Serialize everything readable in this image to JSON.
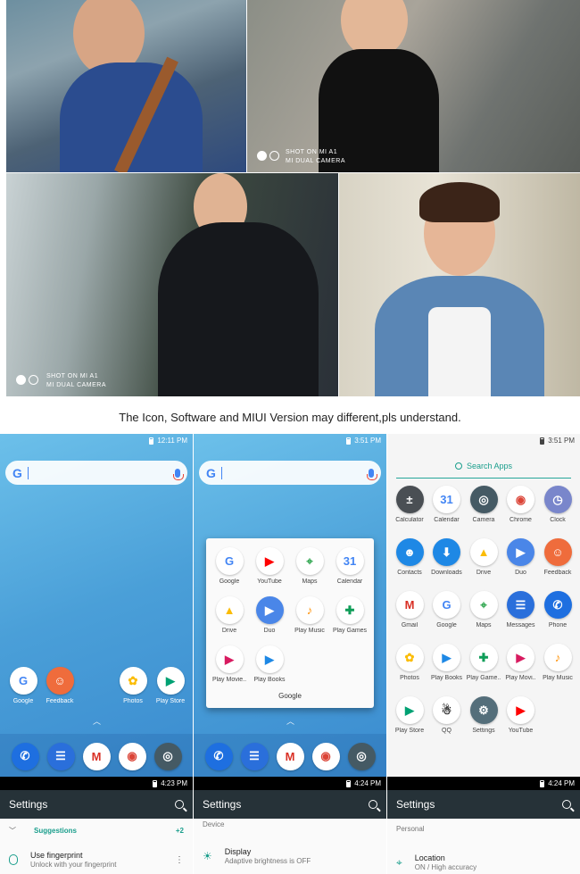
{
  "watermark": {
    "line1": "SHOT ON MI A1",
    "line2": "MI DUAL CAMERA"
  },
  "note": "The Icon, Software and MIUI Version may different,pls understand.",
  "screens": {
    "home": {
      "time": "12:11 PM",
      "apps": [
        "Google",
        "Feedback",
        "Photos",
        "Play Store"
      ],
      "dock": [
        "Phone",
        "Messages",
        "Gmail",
        "Chrome",
        "Camera"
      ]
    },
    "folder_screen": {
      "time": "3:51 PM",
      "folder_title": "Google",
      "apps": [
        "Google",
        "YouTube",
        "Maps",
        "Calendar",
        "Drive",
        "Duo",
        "Play Music",
        "Play Games",
        "Play Movie..",
        "Play Books"
      ],
      "dock": [
        "Phone",
        "Messages",
        "Gmail",
        "Chrome",
        "Camera"
      ]
    },
    "drawer": {
      "time": "3:51 PM",
      "search_label": "Search Apps",
      "apps": [
        "Calculator",
        "Calendar",
        "Camera",
        "Chrome",
        "Clock",
        "Contacts",
        "Downloads",
        "Drive",
        "Duo",
        "Feedback",
        "Gmail",
        "Google",
        "Maps",
        "Messages",
        "Phone",
        "Photos",
        "Play Books",
        "Play Game..",
        "Play Movi..",
        "Play Music",
        "Play Store",
        "QQ",
        "Settings",
        "YouTube"
      ]
    }
  },
  "settings_panels": [
    {
      "time": "4:23 PM",
      "title": "Settings",
      "section": "Suggestions",
      "section_count": "+2",
      "row_title": "Use fingerprint",
      "row_subtitle": "Unlock with your fingerprint"
    },
    {
      "time": "4:24 PM",
      "title": "Settings",
      "section": "Device",
      "row_title": "Display",
      "row_subtitle": "Adaptive brightness is OFF"
    },
    {
      "time": "4:24 PM",
      "title": "Settings",
      "section": "Personal",
      "row_title": "Location",
      "row_subtitle": "ON / High accuracy"
    }
  ],
  "colors": {
    "launcher_bg": "#4a9fd8",
    "settings_toolbar": "#263238",
    "accent_teal": "#1a9e8c"
  },
  "icons": {
    "Google": {
      "bg": "#ffffff",
      "fg": "#4285f4",
      "glyph": "G"
    },
    "Feedback": {
      "bg": "#ef6c3c",
      "fg": "#ffffff",
      "glyph": "☺"
    },
    "Photos": {
      "bg": "#ffffff",
      "fg": "#fbbc05",
      "glyph": "✿"
    },
    "Play Store": {
      "bg": "#ffffff",
      "fg": "#00a173",
      "glyph": "▶"
    },
    "Phone": {
      "bg": "#1e6fe0",
      "fg": "#ffffff",
      "glyph": "✆"
    },
    "Messages": {
      "bg": "#2a6fdb",
      "fg": "#ffffff",
      "glyph": "☰"
    },
    "Gmail": {
      "bg": "#ffffff",
      "fg": "#d93025",
      "glyph": "M"
    },
    "Chrome": {
      "bg": "#ffffff",
      "fg": "#db4437",
      "glyph": "◉"
    },
    "Camera": {
      "bg": "#455a64",
      "fg": "#ffffff",
      "glyph": "◎"
    },
    "YouTube": {
      "bg": "#ffffff",
      "fg": "#ff0000",
      "glyph": "▶"
    },
    "Maps": {
      "bg": "#ffffff",
      "fg": "#34a853",
      "glyph": "⌖"
    },
    "Calendar": {
      "bg": "#ffffff",
      "fg": "#4285f4",
      "glyph": "31"
    },
    "Drive": {
      "bg": "#ffffff",
      "fg": "#fbbc05",
      "glyph": "▲"
    },
    "Duo": {
      "bg": "#4a86e8",
      "fg": "#ffffff",
      "glyph": "▶"
    },
    "Play Music": {
      "bg": "#ffffff",
      "fg": "#ff8f00",
      "glyph": "♪"
    },
    "Play Games": {
      "bg": "#ffffff",
      "fg": "#0f9d58",
      "glyph": "✚"
    },
    "Play Game..": {
      "bg": "#ffffff",
      "fg": "#0f9d58",
      "glyph": "✚"
    },
    "Play Movie..": {
      "bg": "#ffffff",
      "fg": "#d81b60",
      "glyph": "▶"
    },
    "Play Movi..": {
      "bg": "#ffffff",
      "fg": "#d81b60",
      "glyph": "▶"
    },
    "Play Books": {
      "bg": "#ffffff",
      "fg": "#1e88e5",
      "glyph": "▶"
    },
    "Calculator": {
      "bg": "#4a4f54",
      "fg": "#ffffff",
      "glyph": "±"
    },
    "Clock": {
      "bg": "#7986cb",
      "fg": "#ffffff",
      "glyph": "◷"
    },
    "Contacts": {
      "bg": "#1e88e5",
      "fg": "#ffffff",
      "glyph": "☻"
    },
    "Downloads": {
      "bg": "#1e88e5",
      "fg": "#ffffff",
      "glyph": "⬇"
    },
    "QQ": {
      "bg": "#ffffff",
      "fg": "#111111",
      "glyph": "☃"
    },
    "Settings": {
      "bg": "#546e7a",
      "fg": "#ffffff",
      "glyph": "⚙"
    }
  }
}
